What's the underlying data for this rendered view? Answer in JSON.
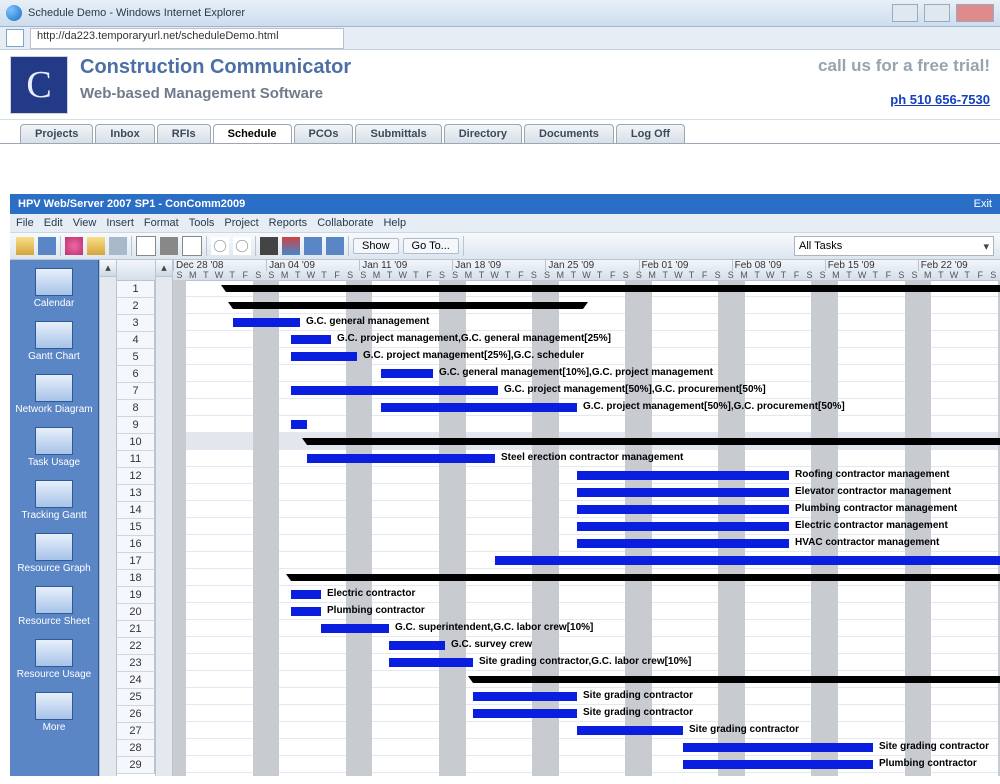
{
  "window": {
    "title": "Schedule Demo - Windows Internet Explorer",
    "url": "http://da223.temporaryurl.net/scheduleDemo.html"
  },
  "hdr": {
    "brand": "Construction Communicator",
    "sub": "Web-based Management Software",
    "call": "call us for a free trial!",
    "phone": "ph 510 656-7530"
  },
  "tabs": [
    "Projects",
    "Inbox",
    "RFIs",
    "Schedule",
    "PCOs",
    "Submittals",
    "Directory",
    "Documents",
    "Log Off"
  ],
  "activeTab": 3,
  "app": {
    "title": "HPV Web/Server 2007 SP1 - ConComm2009",
    "exit": "Exit"
  },
  "menus": [
    "File",
    "Edit",
    "View",
    "Insert",
    "Format",
    "Tools",
    "Project",
    "Reports",
    "Collaborate",
    "Help"
  ],
  "tbar": {
    "show": "Show",
    "goto": "Go To...",
    "filter": "All Tasks"
  },
  "left": [
    {
      "label": "Calendar"
    },
    {
      "label": "Gantt Chart"
    },
    {
      "label": "Network Diagram"
    },
    {
      "label": "Task Usage"
    },
    {
      "label": "Tracking Gantt"
    },
    {
      "label": "Resource Graph"
    },
    {
      "label": "Resource Sheet"
    },
    {
      "label": "Resource Usage"
    },
    {
      "label": "More"
    }
  ],
  "weeks": [
    "Dec 28 '08",
    "Jan 04 '09",
    "Jan 11 '09",
    "Jan 18 '09",
    "Jan 25 '09",
    "Feb 01 '09",
    "Feb 08 '09",
    "Feb 15 '09",
    "Feb 22 '09"
  ],
  "daypattern": "SMTWTFS",
  "rowcount": 29,
  "selectedRow": 10,
  "tasks": [
    {
      "row": 1,
      "type": "sum",
      "start": 53,
      "end": 840,
      "label": ""
    },
    {
      "row": 2,
      "type": "sum",
      "start": 60,
      "end": 410,
      "label": ""
    },
    {
      "row": 3,
      "type": "bar",
      "start": 60,
      "end": 127,
      "label": "G.C. general management"
    },
    {
      "row": 4,
      "type": "bar",
      "start": 118,
      "end": 158,
      "label": "G.C. project management,G.C. general management[25%]"
    },
    {
      "row": 5,
      "type": "bar",
      "start": 118,
      "end": 184,
      "label": "G.C. project management[25%],G.C. scheduler"
    },
    {
      "row": 6,
      "type": "bar",
      "start": 208,
      "end": 260,
      "label": "G.C. general management[10%],G.C. project management"
    },
    {
      "row": 7,
      "type": "bar",
      "start": 118,
      "end": 325,
      "label": "G.C. project management[50%],G.C. procurement[50%]"
    },
    {
      "row": 8,
      "type": "bar",
      "start": 208,
      "end": 404,
      "label": "G.C. project management[50%],G.C. procurement[50%]"
    },
    {
      "row": 9,
      "type": "bar",
      "start": 118,
      "end": 134,
      "label": ""
    },
    {
      "row": 10,
      "type": "sum",
      "start": 134,
      "end": 840,
      "label": ""
    },
    {
      "row": 11,
      "type": "bar",
      "start": 134,
      "end": 322,
      "label": "Steel erection contractor management"
    },
    {
      "row": 12,
      "type": "bar",
      "start": 404,
      "end": 616,
      "label": "Roofing contractor management"
    },
    {
      "row": 13,
      "type": "bar",
      "start": 404,
      "end": 616,
      "label": "Elevator contractor management"
    },
    {
      "row": 14,
      "type": "bar",
      "start": 404,
      "end": 616,
      "label": "Plumbing contractor management"
    },
    {
      "row": 15,
      "type": "bar",
      "start": 404,
      "end": 616,
      "label": "Electric contractor management"
    },
    {
      "row": 16,
      "type": "bar",
      "start": 404,
      "end": 616,
      "label": "HVAC contractor management"
    },
    {
      "row": 17,
      "type": "bar",
      "start": 322,
      "end": 840,
      "label": ""
    },
    {
      "row": 18,
      "type": "sum",
      "start": 118,
      "end": 840,
      "label": ""
    },
    {
      "row": 19,
      "type": "bar",
      "start": 118,
      "end": 148,
      "label": "Electric contractor"
    },
    {
      "row": 20,
      "type": "bar",
      "start": 118,
      "end": 148,
      "label": "Plumbing contractor"
    },
    {
      "row": 21,
      "type": "bar",
      "start": 148,
      "end": 216,
      "label": "G.C. superintendent,G.C. labor crew[10%]"
    },
    {
      "row": 22,
      "type": "bar",
      "start": 216,
      "end": 272,
      "label": "G.C. survey crew"
    },
    {
      "row": 23,
      "type": "bar",
      "start": 216,
      "end": 300,
      "label": "Site grading contractor,G.C. labor crew[10%]"
    },
    {
      "row": 24,
      "type": "sum",
      "start": 300,
      "end": 840,
      "label": ""
    },
    {
      "row": 25,
      "type": "bar",
      "start": 300,
      "end": 404,
      "label": "Site grading contractor"
    },
    {
      "row": 26,
      "type": "bar",
      "start": 300,
      "end": 404,
      "label": "Site grading contractor"
    },
    {
      "row": 27,
      "type": "bar",
      "start": 404,
      "end": 510,
      "label": "Site grading contractor"
    },
    {
      "row": 28,
      "type": "bar",
      "start": 510,
      "end": 700,
      "label": "Site grading contractor"
    },
    {
      "row": 29,
      "type": "bar",
      "start": 510,
      "end": 700,
      "label": "Plumbing contractor"
    }
  ],
  "chart_data": {
    "type": "gantt",
    "timescale_unit": "days",
    "start_date": "2008-12-28",
    "columns_per_week": 7,
    "rows": 29
  }
}
